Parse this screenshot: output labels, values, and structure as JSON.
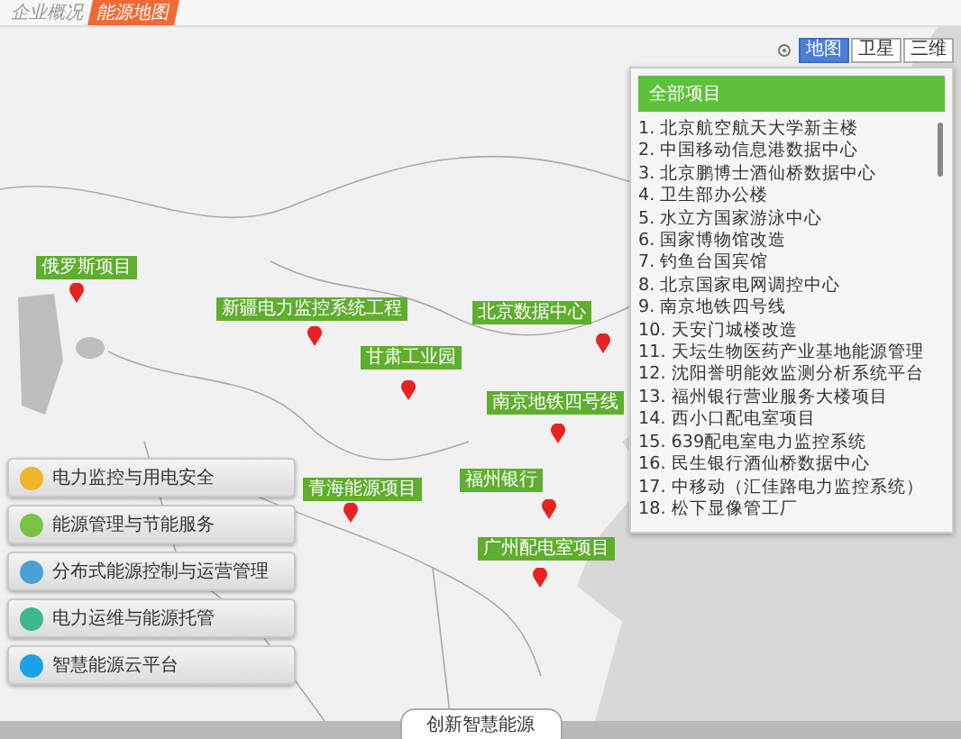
{
  "header": {
    "subtitle": "企业概况",
    "badge": "能源地图"
  },
  "map_types": [
    {
      "label": "地图",
      "selected": true
    },
    {
      "label": "卫星",
      "selected": false
    },
    {
      "label": "三维",
      "selected": false
    }
  ],
  "project_panel": {
    "title": "全部项目",
    "items": [
      "1.  北京航空航天大学新主楼",
      "2.  中国移动信息港数据中心",
      "3.  北京鹏博士酒仙桥数据中心",
      "4.  卫生部办公楼",
      "5.  水立方国家游泳中心",
      "6.  国家博物馆改造",
      "7.  钓鱼台国宾馆",
      "8.  北京国家电网调控中心",
      "9.  南京地铁四号线",
      "10.  天安门城楼改造",
      "11.  天坛生物医药产业基地能源管理",
      "12.  沈阳誉明能效监测分析系统平台",
      "13.  福州银行营业服务大楼项目",
      "14.  西小口配电室项目",
      "15.  639配电室电力监控系统",
      "16.  民生银行酒仙桥数据中心",
      "17.  中移动（汇佳路电力监控系统）",
      "18.  松下显像管工厂"
    ]
  },
  "markers": [
    "俄罗斯项目",
    "新疆电力监控系统工程",
    "甘肃工业园",
    "青海能源项目",
    "北京数据中心",
    "南京地铁四号线",
    "福州银行",
    "广州配电室项目"
  ],
  "menu": [
    {
      "label": "电力监控与用电安全",
      "color": "#f0b429"
    },
    {
      "label": "能源管理与节能服务",
      "color": "#7cc242"
    },
    {
      "label": "分布式能源控制与运营管理",
      "color": "#4a9fd8"
    },
    {
      "label": "电力运维与能源托管",
      "color": "#3cb88a"
    },
    {
      "label": "智慧能源云平台",
      "color": "#1ea0e8"
    }
  ],
  "bottom_tab": "创新智慧能源"
}
